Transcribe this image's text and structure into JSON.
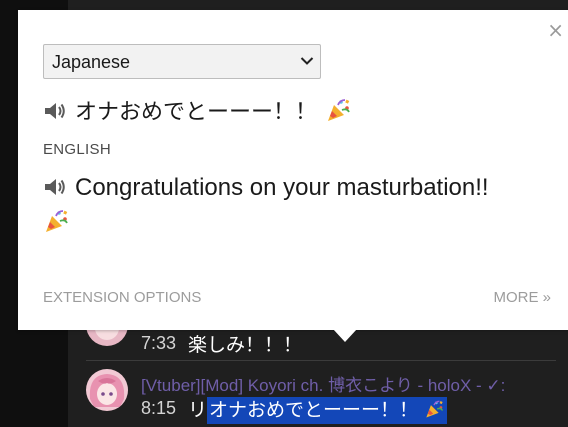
{
  "popup": {
    "close_label": "×",
    "language_select": {
      "value": "Japanese"
    },
    "source_text": "オナおめでとーーー！！",
    "target_language": "ENGLISH",
    "translation": "Congratulations on your masturbation!!",
    "extension_options_label": "EXTENSION OPTIONS",
    "more_label": "MORE »",
    "icons": [
      "speaker-icon",
      "party-popper-icon",
      "chevron-down-icon",
      "close-icon"
    ]
  },
  "chat": {
    "messages": [
      {
        "author": "",
        "timestamp": "7:33",
        "text": "楽しみ！！！"
      },
      {
        "author": "[Vtuber][Mod] Koyori ch. 博衣こより - holoX - ✓:",
        "timestamp": "8:15",
        "text_prefix": "リ",
        "text_selected": "オナおめでとーーー！！"
      }
    ],
    "colors": {
      "background": "#1f1f1f",
      "author": "#6f5ea8",
      "selection": "#1347b8"
    }
  }
}
